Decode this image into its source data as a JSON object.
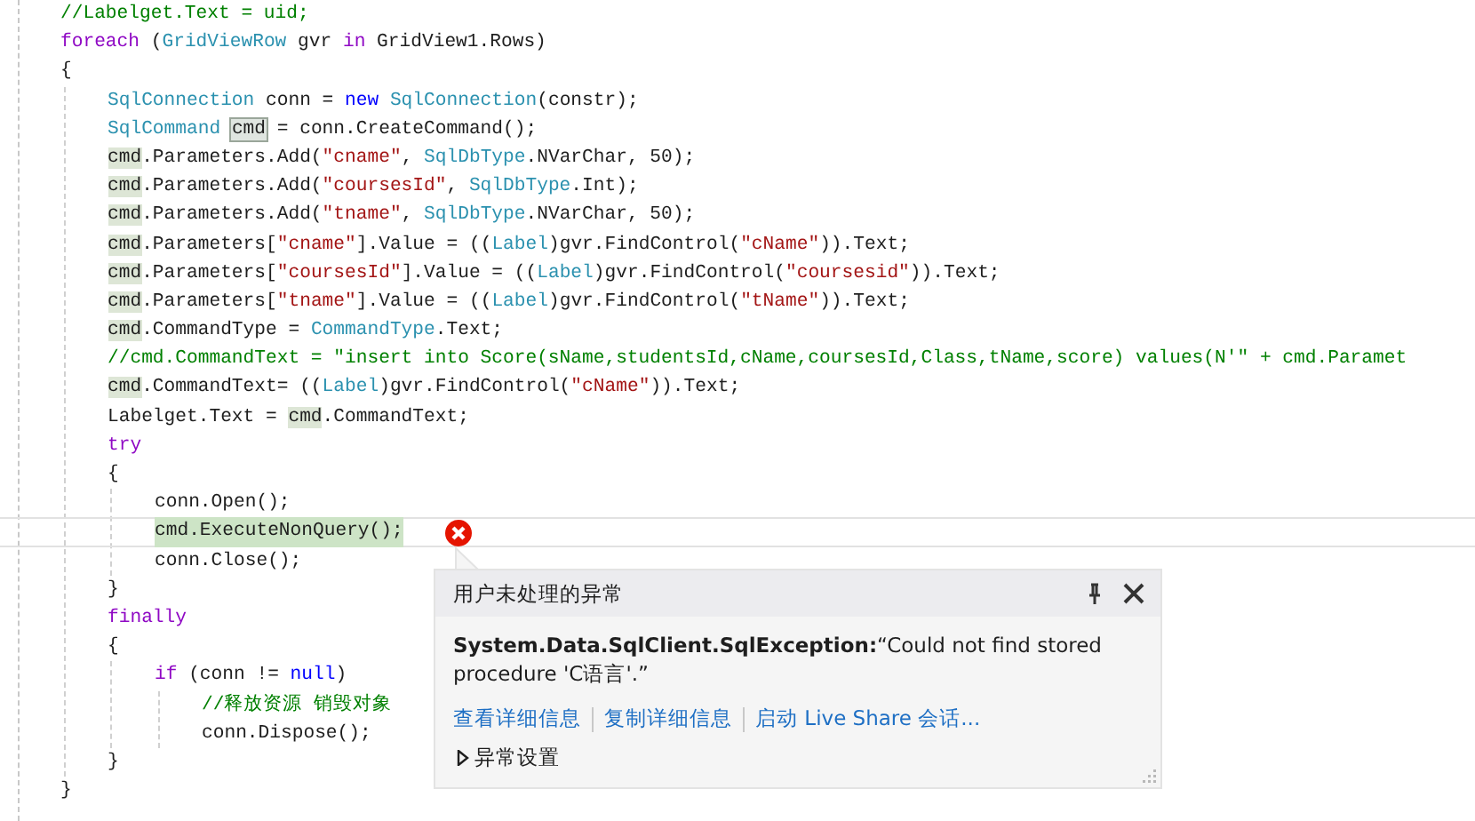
{
  "code_lines": [
    {
      "tokens": [
        {
          "kind": "comment",
          "text": "//Labelget.Text = uid;"
        }
      ]
    },
    {
      "tokens": [
        {
          "kind": "keyword",
          "text": "foreach"
        },
        {
          "kind": "plain",
          "text": " ("
        },
        {
          "kind": "type",
          "text": "GridViewRow"
        },
        {
          "kind": "plain",
          "text": " gvr "
        },
        {
          "kind": "keyword",
          "text": "in"
        },
        {
          "kind": "plain",
          "text": " GridView1.Rows)"
        }
      ]
    },
    {
      "tokens": [
        {
          "kind": "plain",
          "text": "{"
        }
      ],
      "children": [
        {
          "tokens": [
            {
              "kind": "type",
              "text": "SqlConnection"
            },
            {
              "kind": "plain",
              "text": " conn = "
            },
            {
              "kind": "keyword2",
              "text": "new"
            },
            {
              "kind": "type",
              "text": " SqlConnection"
            },
            {
              "kind": "plain",
              "text": "(constr);"
            }
          ]
        },
        {
          "tokens": [
            {
              "kind": "type",
              "text": "SqlCommand "
            },
            {
              "kind": "selected",
              "text": "cmd"
            },
            {
              "kind": "plain",
              "text": " = conn.CreateCommand();"
            }
          ]
        },
        {
          "tokens": [
            {
              "kind": "ref",
              "text": "cmd"
            },
            {
              "kind": "plain",
              "text": ".Parameters.Add("
            },
            {
              "kind": "string",
              "text": "\"cname\""
            },
            {
              "kind": "plain",
              "text": ", "
            },
            {
              "kind": "type",
              "text": "SqlDbType"
            },
            {
              "kind": "plain",
              "text": ".NVarChar, 50);"
            }
          ]
        },
        {
          "tokens": [
            {
              "kind": "ref",
              "text": "cmd"
            },
            {
              "kind": "plain",
              "text": ".Parameters.Add("
            },
            {
              "kind": "string",
              "text": "\"coursesId\""
            },
            {
              "kind": "plain",
              "text": ", "
            },
            {
              "kind": "type",
              "text": "SqlDbType"
            },
            {
              "kind": "plain",
              "text": ".Int);"
            }
          ]
        },
        {
          "tokens": [
            {
              "kind": "ref",
              "text": "cmd"
            },
            {
              "kind": "plain",
              "text": ".Parameters.Add("
            },
            {
              "kind": "string",
              "text": "\"tname\""
            },
            {
              "kind": "plain",
              "text": ", "
            },
            {
              "kind": "type",
              "text": "SqlDbType"
            },
            {
              "kind": "plain",
              "text": ".NVarChar, 50);"
            }
          ]
        },
        {
          "tokens": [
            {
              "kind": "ref",
              "text": "cmd"
            },
            {
              "kind": "plain",
              "text": ".Parameters["
            },
            {
              "kind": "string",
              "text": "\"cname\""
            },
            {
              "kind": "plain",
              "text": "].Value = (("
            },
            {
              "kind": "type",
              "text": "Label"
            },
            {
              "kind": "plain",
              "text": ")gvr.FindControl("
            },
            {
              "kind": "string",
              "text": "\"cName\""
            },
            {
              "kind": "plain",
              "text": ")).Text;"
            }
          ]
        },
        {
          "tokens": [
            {
              "kind": "ref",
              "text": "cmd"
            },
            {
              "kind": "plain",
              "text": ".Parameters["
            },
            {
              "kind": "string",
              "text": "\"coursesId\""
            },
            {
              "kind": "plain",
              "text": "].Value = (("
            },
            {
              "kind": "type",
              "text": "Label"
            },
            {
              "kind": "plain",
              "text": ")gvr.FindControl("
            },
            {
              "kind": "string",
              "text": "\"coursesid\""
            },
            {
              "kind": "plain",
              "text": ")).Text;"
            }
          ]
        },
        {
          "tokens": [
            {
              "kind": "ref",
              "text": "cmd"
            },
            {
              "kind": "plain",
              "text": ".Parameters["
            },
            {
              "kind": "string",
              "text": "\"tname\""
            },
            {
              "kind": "plain",
              "text": "].Value = (("
            },
            {
              "kind": "type",
              "text": "Label"
            },
            {
              "kind": "plain",
              "text": ")gvr.FindControl("
            },
            {
              "kind": "string",
              "text": "\"tName\""
            },
            {
              "kind": "plain",
              "text": ")).Text;"
            }
          ]
        },
        {
          "tokens": [
            {
              "kind": "ref",
              "text": "cmd"
            },
            {
              "kind": "plain",
              "text": ".CommandType = "
            },
            {
              "kind": "type",
              "text": "CommandType"
            },
            {
              "kind": "plain",
              "text": ".Text;"
            }
          ]
        },
        {
          "tokens": [
            {
              "kind": "comment",
              "text": "//cmd.CommandText = \"insert into Score(sName,studentsId,cName,coursesId,Class,tName,score) values(N'\" + cmd.Paramet"
            }
          ]
        },
        {
          "tokens": [
            {
              "kind": "ref",
              "text": "cmd"
            },
            {
              "kind": "plain",
              "text": ".CommandText= (("
            },
            {
              "kind": "type",
              "text": "Label"
            },
            {
              "kind": "plain",
              "text": ")gvr.FindControl("
            },
            {
              "kind": "string",
              "text": "\"cName\""
            },
            {
              "kind": "plain",
              "text": ")).Text;"
            }
          ]
        },
        {
          "tokens": [
            {
              "kind": "plain",
              "text": "Labelget.Text = "
            },
            {
              "kind": "ref",
              "text": "cmd"
            },
            {
              "kind": "plain",
              "text": ".CommandText;"
            }
          ]
        },
        {
          "tokens": [
            {
              "kind": "keyword",
              "text": "try"
            }
          ]
        },
        {
          "tokens": [
            {
              "kind": "plain",
              "text": "{"
            }
          ],
          "children": [
            {
              "tokens": [
                {
                  "kind": "plain",
                  "text": "conn.Open();"
                }
              ]
            },
            {
              "tokens": [
                {
                  "kind": "plain",
                  "text": "cmd.ExecuteNonQuery();"
                }
              ],
              "current": true
            },
            {
              "tokens": [
                {
                  "kind": "plain",
                  "text": "conn.Close();"
                }
              ]
            }
          ]
        },
        {
          "tokens": [
            {
              "kind": "plain",
              "text": "}"
            }
          ]
        },
        {
          "tokens": [
            {
              "kind": "keyword",
              "text": "finally"
            }
          ]
        },
        {
          "tokens": [
            {
              "kind": "plain",
              "text": "{"
            }
          ],
          "children": [
            {
              "tokens": [
                {
                  "kind": "keyword",
                  "text": "if"
                },
                {
                  "kind": "plain",
                  "text": " (conn != "
                },
                {
                  "kind": "keyword2",
                  "text": "null"
                },
                {
                  "kind": "plain",
                  "text": ")"
                }
              ],
              "children": [
                {
                  "tokens": [
                    {
                      "kind": "comment",
                      "text": "//释放资源 销毁对象"
                    }
                  ]
                },
                {
                  "tokens": [
                    {
                      "kind": "plain",
                      "text": "conn.Dispose();"
                    }
                  ]
                }
              ]
            }
          ]
        },
        {
          "tokens": [
            {
              "kind": "plain",
              "text": "}"
            }
          ]
        }
      ]
    },
    {
      "tokens": [
        {
          "kind": "plain",
          "text": "}"
        }
      ]
    }
  ],
  "exception_popup": {
    "title": "用户未处理的异常",
    "message": "**System.Data.SqlClient.SqlException:**“Could not find stored procedure 'C语言'.”",
    "links": [
      "查看详细信息",
      "复制详细信息",
      "启动 Live Share 会话..."
    ],
    "settings": {
      "label": "异常设置",
      "expanded": false
    }
  }
}
